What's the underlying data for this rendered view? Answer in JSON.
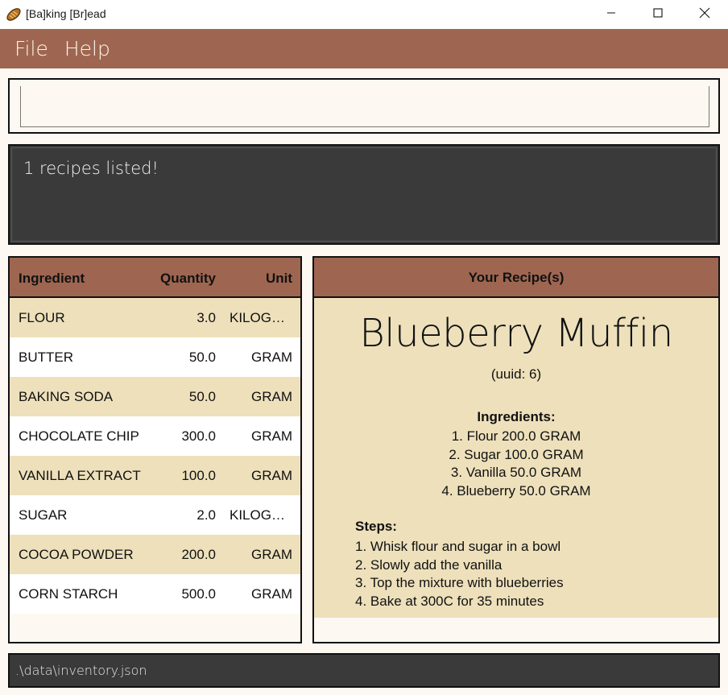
{
  "window": {
    "title": "[Ba]king [Br]ead",
    "icon": "bread-icon"
  },
  "menu": {
    "items": [
      {
        "label": "File"
      },
      {
        "label": "Help"
      }
    ]
  },
  "command": {
    "value": "",
    "placeholder": ""
  },
  "result": {
    "message": "1 recipes listed!"
  },
  "inventory": {
    "headers": {
      "ingredient": "Ingredient",
      "quantity": "Quantity",
      "unit": "Unit"
    },
    "rows": [
      {
        "name": "FLOUR",
        "quantity": "3.0",
        "unit": "KILOGRAM"
      },
      {
        "name": "BUTTER",
        "quantity": "50.0",
        "unit": "GRAM"
      },
      {
        "name": "BAKING SODA",
        "quantity": "50.0",
        "unit": "GRAM"
      },
      {
        "name": "CHOCOLATE CHIP",
        "quantity": "300.0",
        "unit": "GRAM"
      },
      {
        "name": "VANILLA EXTRACT",
        "quantity": "100.0",
        "unit": "GRAM"
      },
      {
        "name": "SUGAR",
        "quantity": "2.0",
        "unit": "KILOGRAM"
      },
      {
        "name": "COCOA POWDER",
        "quantity": "200.0",
        "unit": "GRAM"
      },
      {
        "name": "CORN STARCH",
        "quantity": "500.0",
        "unit": "GRAM"
      }
    ]
  },
  "recipes": {
    "header": "Your Recipe(s)",
    "recipe": {
      "name": "Blueberry Muffin",
      "uuid": "(uuid: 6)",
      "ingredients_title": "Ingredients:",
      "ingredients": [
        "1. Flour 200.0 GRAM",
        "2. Sugar 100.0 GRAM",
        "3. Vanilla 50.0 GRAM",
        "4. Blueberry 50.0 GRAM"
      ],
      "steps_title": "Steps:",
      "steps": [
        "1. Whisk flour and sugar in a bowl",
        "2. Slowly add the vanilla",
        "3. Top the mixture with blueberries",
        "4. Bake at 300C for 35 minutes"
      ]
    }
  },
  "status": {
    "path": ".\\data\\inventory.json"
  },
  "colors": {
    "accent": "#9e6651",
    "row_alt": "#ede0bb",
    "dark_panel": "#3a3a3a",
    "background": "#fdf8f1"
  }
}
